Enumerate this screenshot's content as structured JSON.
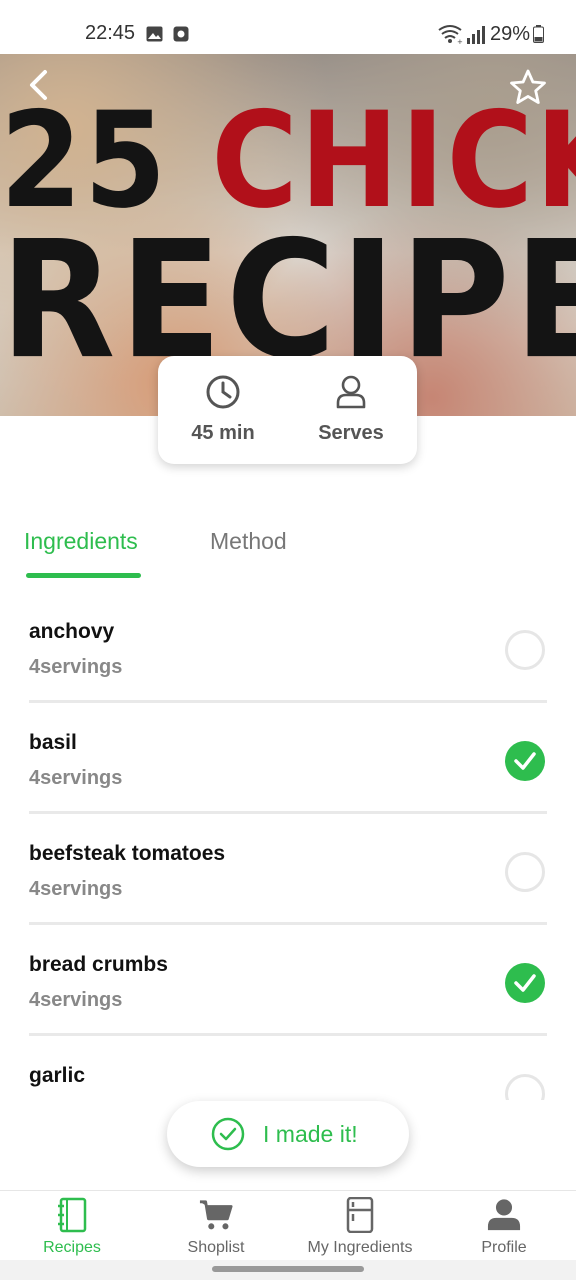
{
  "status_bar": {
    "time": "22:45",
    "battery": "29%",
    "icons": [
      "image-icon",
      "record-icon",
      "wifi-icon",
      "signal-icon",
      "battery-icon"
    ]
  },
  "hero": {
    "title_number": "25",
    "title_word": "CHICKEN",
    "title_line2": "RECIPES",
    "icons": {
      "back": "chevron-left-icon",
      "favorite": "star-icon"
    }
  },
  "info": {
    "time": "45 min",
    "serves": "Serves",
    "icons": {
      "time": "clock-icon",
      "serves": "person-icon"
    }
  },
  "tabs": [
    {
      "label": "Ingredients",
      "active": true
    },
    {
      "label": "Method",
      "active": false
    }
  ],
  "ingredients": [
    {
      "name": "anchovy",
      "amount": "4servings",
      "checked": false
    },
    {
      "name": "basil",
      "amount": "4servings",
      "checked": true
    },
    {
      "name": "beefsteak tomatoes",
      "amount": "4servings",
      "checked": false
    },
    {
      "name": "bread crumbs",
      "amount": "4servings",
      "checked": true
    },
    {
      "name": "garlic",
      "amount": "",
      "checked": false
    }
  ],
  "made_it": {
    "label": "I made it!",
    "icon": "check-circle-icon"
  },
  "bottom_nav": [
    {
      "label": "Recipes",
      "icon": "notebook-icon",
      "active": true
    },
    {
      "label": "Shoplist",
      "icon": "cart-icon",
      "active": false
    },
    {
      "label": "My Ingredients",
      "icon": "fridge-icon",
      "active": false
    },
    {
      "label": "Profile",
      "icon": "user-icon",
      "active": false
    }
  ],
  "colors": {
    "accent": "#2ebd4e",
    "title_red": "#b1101a",
    "muted": "#888888"
  }
}
